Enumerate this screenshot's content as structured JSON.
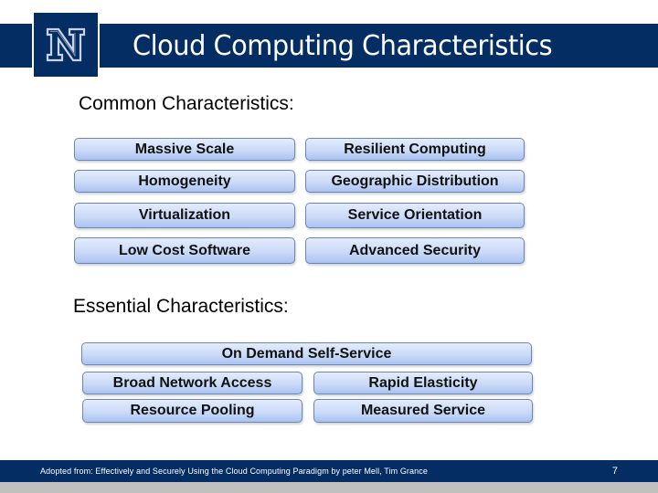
{
  "header": {
    "logo_icon": "university-n-logo",
    "title": "Cloud Computing Characteristics"
  },
  "common": {
    "heading": "Common Characteristics:",
    "items": [
      "Massive Scale",
      "Resilient Computing",
      "Homogeneity",
      "Geographic Distribution",
      "Virtualization",
      "Service Orientation",
      "Low Cost Software",
      "Advanced Security"
    ]
  },
  "essential": {
    "heading": "Essential Characteristics:",
    "items": [
      "On Demand Self-Service",
      "Broad Network Access",
      "Rapid Elasticity",
      "Resource Pooling",
      "Measured Service"
    ]
  },
  "footer": {
    "credit": "Adopted from: Effectively and Securely Using the Cloud Computing Paradigm by peter Mell, Tim Grance",
    "slide_number": "7"
  },
  "colors": {
    "brand_navy": "#032d63",
    "pill_top": "#e3ecfc",
    "pill_bottom": "#a9c3f2",
    "footer_gray": "#c0c0c0"
  }
}
